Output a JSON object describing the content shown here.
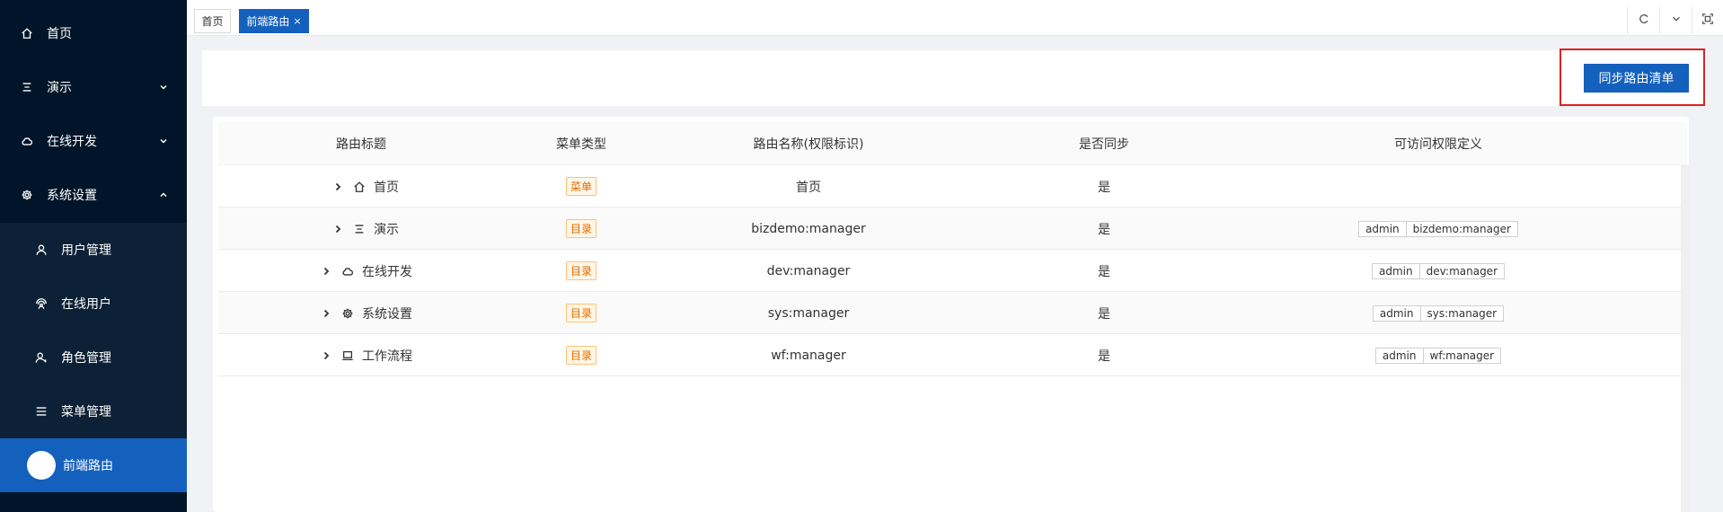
{
  "sidebar": {
    "items": [
      {
        "label": "首页",
        "icon": "home-icon"
      },
      {
        "label": "演示",
        "icon": "list-icon",
        "arrow": "chevron-down"
      },
      {
        "label": "在线开发",
        "icon": "cloud-icon",
        "arrow": "chevron-down"
      },
      {
        "label": "系统设置",
        "icon": "gear-icon",
        "arrow": "chevron-up"
      }
    ],
    "subitems": [
      {
        "label": "用户管理",
        "icon": "user-icon"
      },
      {
        "label": "在线用户",
        "icon": "online-user-icon"
      },
      {
        "label": "角色管理",
        "icon": "role-icon"
      },
      {
        "label": "菜单管理",
        "icon": "menu-icon"
      },
      {
        "label": "前端路由",
        "icon": "active-dot",
        "active": true
      }
    ]
  },
  "tabs": [
    {
      "label": "首页"
    },
    {
      "label": "前端路由",
      "close": "×",
      "active": true
    }
  ],
  "toolbar": {
    "sync_label": "同步路由清单"
  },
  "table": {
    "columns": [
      "路由标题",
      "菜单类型",
      "路由名称(权限标识)",
      "是否同步",
      "可访问权限定义"
    ],
    "rows": [
      {
        "title": "首页",
        "icon": "home-icon",
        "type": "菜单",
        "name": "首页",
        "synced": "是",
        "perms": []
      },
      {
        "title": "演示",
        "icon": "list-icon",
        "type": "目录",
        "name": "bizdemo:manager",
        "synced": "是",
        "perms": [
          "admin",
          "bizdemo:manager"
        ]
      },
      {
        "title": "在线开发",
        "icon": "cloud-icon",
        "type": "目录",
        "name": "dev:manager",
        "synced": "是",
        "perms": [
          "admin",
          "dev:manager"
        ]
      },
      {
        "title": "系统设置",
        "icon": "gear-icon",
        "type": "目录",
        "name": "sys:manager",
        "synced": "是",
        "perms": [
          "admin",
          "sys:manager"
        ]
      },
      {
        "title": "工作流程",
        "icon": "laptop-icon",
        "type": "目录",
        "name": "wf:manager",
        "synced": "是",
        "perms": [
          "admin",
          "wf:manager"
        ]
      }
    ]
  },
  "colors": {
    "sidebar_bg": "#001529",
    "submenu_bg": "#0c2135",
    "primary": "#1460bd",
    "highlight": "#e02020",
    "badge_text": "#e06b00"
  }
}
